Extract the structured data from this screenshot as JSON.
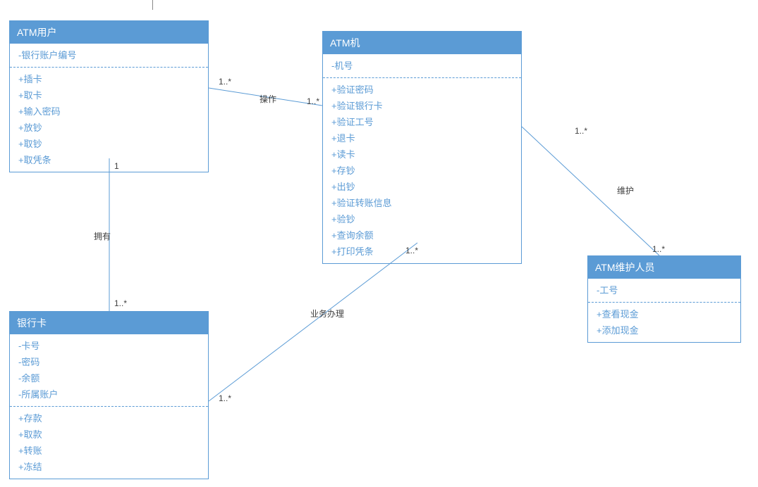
{
  "classes": {
    "atmUser": {
      "name": "ATM用户",
      "attributes": [
        "-银行账户编号"
      ],
      "operations": [
        "+插卡",
        "+取卡",
        "+输入密码",
        "+放钞",
        "+取钞",
        "+取凭条"
      ]
    },
    "atmMachine": {
      "name": "ATM机",
      "attributes": [
        "-机号"
      ],
      "operations": [
        "+验证密码",
        "+验证银行卡",
        "+验证工号",
        "+退卡",
        "+读卡",
        "+存钞",
        "+出钞",
        "+验证转账信息",
        "+验钞",
        "+查询余额",
        "+打印凭条"
      ]
    },
    "bankCard": {
      "name": "银行卡",
      "attributes": [
        "-卡号",
        "-密码",
        "-余额",
        "-所属账户"
      ],
      "operations": [
        "+存款",
        "+取款",
        "+转账",
        "+冻结"
      ]
    },
    "atmStaff": {
      "name": "ATM维护人员",
      "attributes": [
        "-工号"
      ],
      "operations": [
        "+查看现金",
        "+添加现金"
      ]
    }
  },
  "associations": {
    "userMachine": {
      "label": "操作",
      "multA": "1..*",
      "multB": "1..*"
    },
    "userCard": {
      "label": "拥有",
      "multA": "1",
      "multB": "1..*"
    },
    "cardMachine": {
      "label": "业务办理",
      "multA": "1..*",
      "multB": "1..*"
    },
    "machineStaff": {
      "label": "维护",
      "multA": "1..*",
      "multB": "1..*"
    }
  }
}
